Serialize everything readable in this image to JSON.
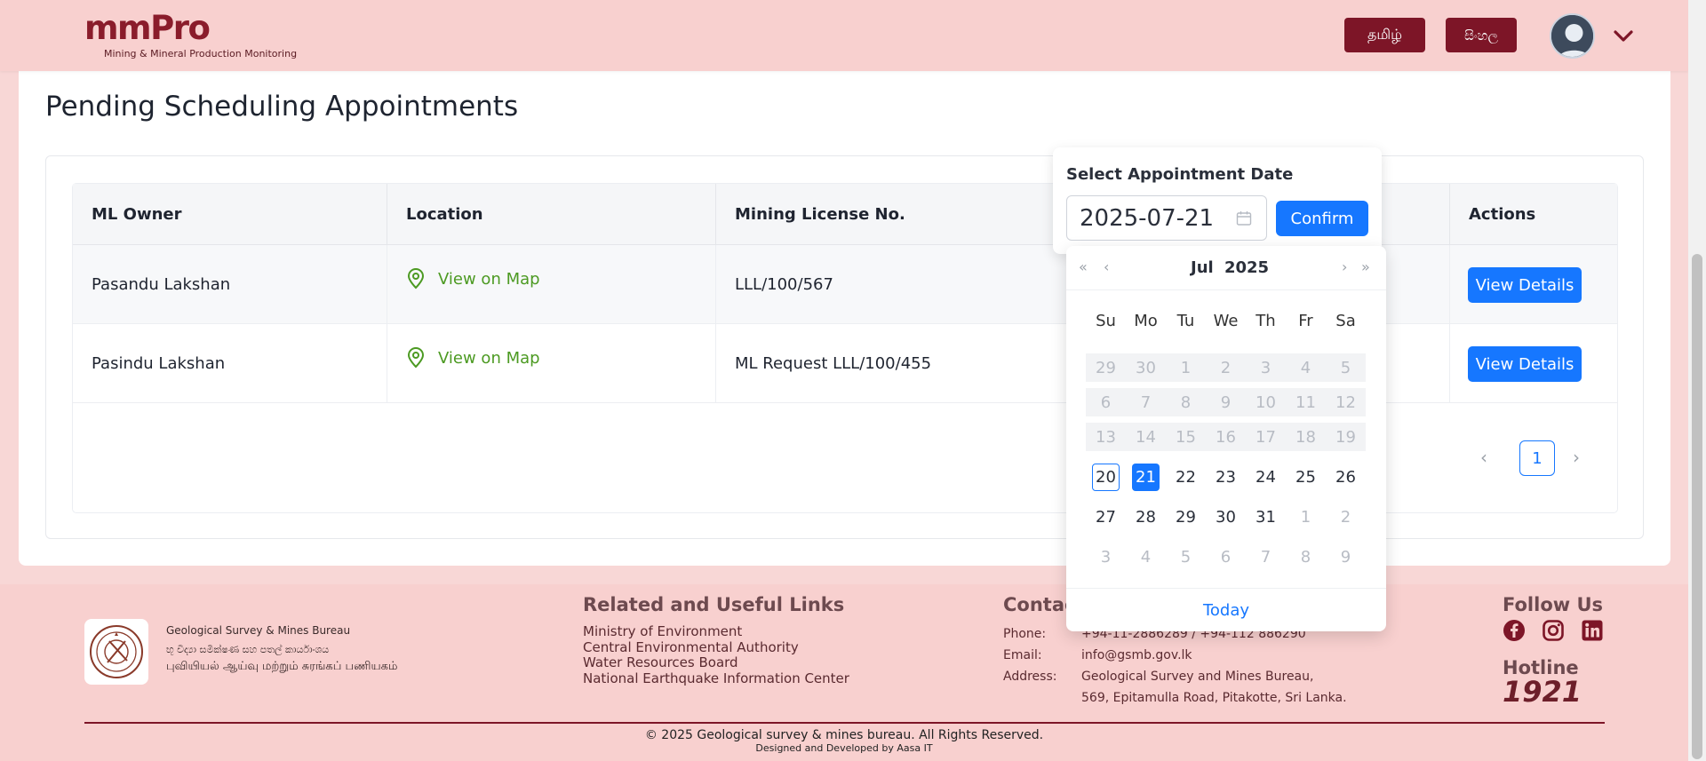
{
  "header": {
    "logo_main": "mmPro",
    "logo_sub": "Mining & Mineral Production Monitoring",
    "lang_tamil": "தமிழ்",
    "lang_sinhala": "සිංහල"
  },
  "page": {
    "title": "Pending Scheduling Appointments"
  },
  "table": {
    "headers": {
      "owner": "ML Owner",
      "location": "Location",
      "license": "Mining License No.",
      "actions": "Actions"
    },
    "rows": [
      {
        "owner": "Pasandu Lakshan",
        "location": "View on Map",
        "license": "LLL/100/567",
        "action": "View Details"
      },
      {
        "owner": "Pasindu Lakshan",
        "location": "View on Map",
        "license": "ML Request LLL/100/455",
        "action": "View Details"
      }
    ],
    "pagination": {
      "current_page": "1",
      "prev": "‹",
      "next": "›"
    }
  },
  "popup": {
    "title": "Select Appointment Date",
    "date_value": "2025-07-21",
    "confirm_label": "Confirm"
  },
  "calendar": {
    "month": "Jul",
    "year": "2025",
    "nav": {
      "super_prev": "«",
      "prev": "‹",
      "next": "›",
      "super_next": "»"
    },
    "weekdays": [
      "Su",
      "Mo",
      "Tu",
      "We",
      "Th",
      "Fr",
      "Sa"
    ],
    "weeks": [
      [
        "29",
        "30",
        "1",
        "2",
        "3",
        "4",
        "5"
      ],
      [
        "6",
        "7",
        "8",
        "9",
        "10",
        "11",
        "12"
      ],
      [
        "13",
        "14",
        "15",
        "16",
        "17",
        "18",
        "19"
      ],
      [
        "20",
        "21",
        "22",
        "23",
        "24",
        "25",
        "26"
      ],
      [
        "27",
        "28",
        "29",
        "30",
        "31",
        "1",
        "2"
      ],
      [
        "3",
        "4",
        "5",
        "6",
        "7",
        "8",
        "9"
      ]
    ],
    "today_label": "Today",
    "today_day": "20",
    "selected_day": "21"
  },
  "footer": {
    "org_name": "Geological Survey & Mines Bureau",
    "org_sinhala": "භූ විද්‍යා සමීක්ෂණ සහ පතල් කාර්යාංශය",
    "org_tamil": "புவியியல் ஆய்வு மற்றும் சுரங்கப் பணியகம்",
    "links_heading": "Related and Useful Links",
    "links": [
      "Ministry of Environment",
      "Central Environmental Authority",
      "Water Resources Board",
      "National Earthquake Information Center"
    ],
    "contact_heading": "Contact Us",
    "phone_label": "Phone:",
    "phone_value": "+94-11-2886289 / +94-112 886290",
    "email_label": "Email:",
    "email_value": "info@gsmb.gov.lk",
    "address_label": "Address:",
    "address_line1": "Geological Survey and Mines Bureau,",
    "address_line2": "569, Epitamulla Road, Pitakotte, Sri Lanka.",
    "follow_heading": "Follow Us",
    "hotline_heading": "Hotline",
    "hotline_number": "1921",
    "copyright": "© 2025 Geological survey & mines bureau. All Rights Reserved.",
    "designed_by": "Designed and Developed by Aasa IT"
  },
  "colors": {
    "brand": "#7d1527",
    "primary": "#1677ff",
    "map_link": "#4c9a22",
    "header_bg": "#f8d0cf"
  }
}
